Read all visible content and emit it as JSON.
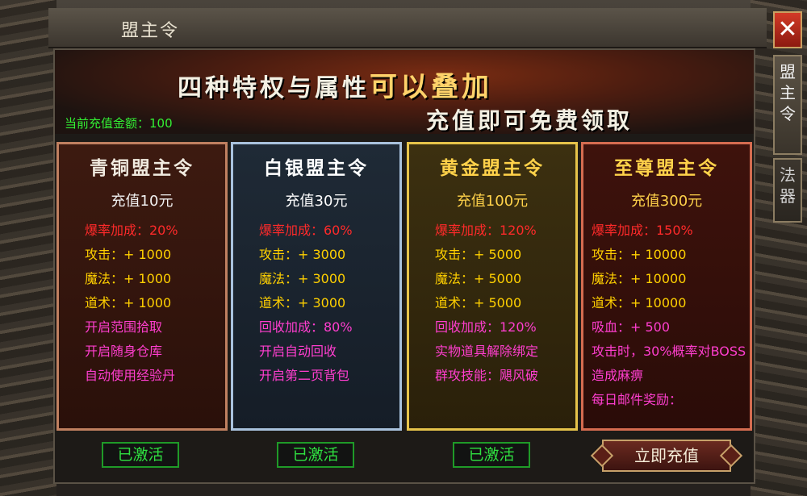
{
  "window": {
    "title": "盟主令",
    "close_glyph": "✕"
  },
  "side_tabs": [
    {
      "label": "盟\n主\n令"
    },
    {
      "label": "法\n器"
    }
  ],
  "banner": {
    "line1_prefix": "四种特权与属性",
    "line1_highlight": "可以叠加",
    "line2": "充值即可免费领取"
  },
  "balance": "当前充值金额：100",
  "cards": [
    {
      "name": "青铜盟主令",
      "price": "充值10元",
      "lines": [
        "爆率加成：20%",
        "攻击：+ 1000",
        "魔法：+ 1000",
        "道术：+ 1000",
        "开启范围拾取",
        "开启随身仓库",
        "自动使用经验丹"
      ],
      "status": "已激活"
    },
    {
      "name": "白银盟主令",
      "price": "充值30元",
      "lines": [
        "爆率加成：60%",
        "攻击：+ 3000",
        "魔法：+ 3000",
        "道术：+ 3000",
        "回收加成：80%",
        "开启自动回收",
        "开启第二页背包"
      ],
      "status": "已激活"
    },
    {
      "name": "黄金盟主令",
      "price": "充值100元",
      "lines": [
        "爆率加成：120%",
        "攻击：+ 5000",
        "魔法：+ 5000",
        "道术：+ 5000",
        "回收加成：120%",
        "实物道具解除绑定",
        "群攻技能：飓风破"
      ],
      "status": "已激活"
    },
    {
      "name": "至尊盟主令",
      "price": "充值300元",
      "lines": [
        "爆率加成：150%",
        "攻击：+ 10000",
        "魔法：+ 10000",
        "道术：+ 10000",
        "吸血：+ 500",
        "攻击时，30%概率对BOSS造成麻痹",
        "每日邮件奖励："
      ],
      "action": "立即充值"
    }
  ],
  "colors": {
    "red": "#ff2a2a",
    "yellow": "#ffd000",
    "magenta": "#ff3ecf",
    "green": "#2fe040"
  }
}
